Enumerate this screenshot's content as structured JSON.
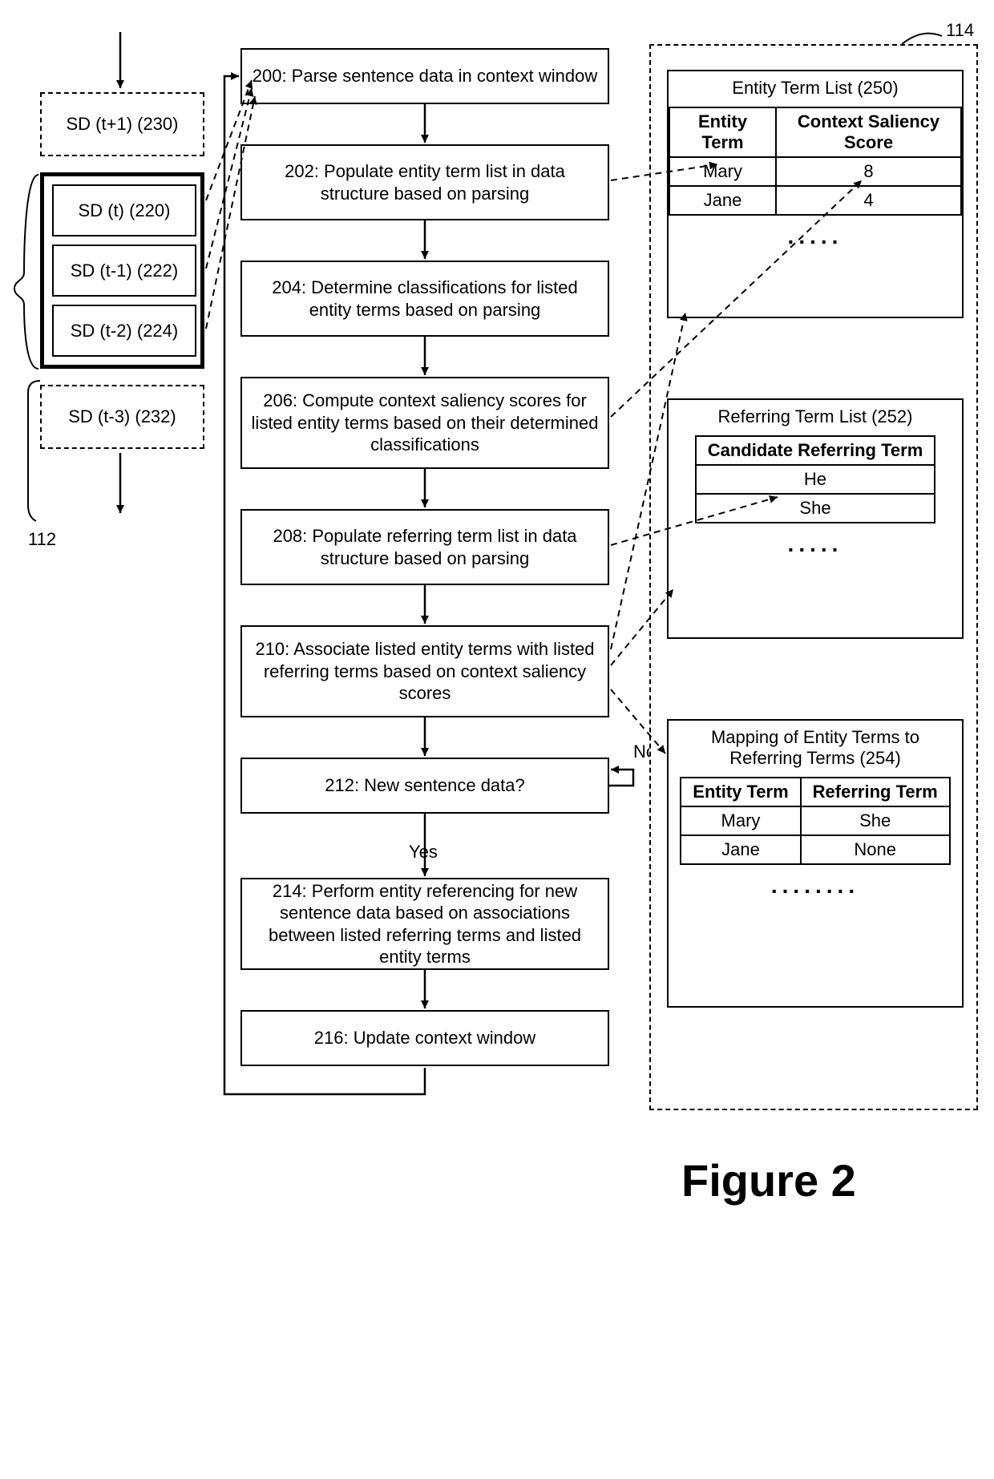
{
  "figure_label": "Figure 2",
  "refs": {
    "window_callout": "112",
    "data_structure_callout": "114"
  },
  "sd_stack": {
    "above": "SD (t+1) (230)",
    "rows": [
      "SD (t) (220)",
      "SD (t-1) (222)",
      "SD (t-2) (224)"
    ],
    "below": "SD (t-3) (232)"
  },
  "flow": {
    "s200": "200:  Parse sentence data in context window",
    "s202": "202:  Populate entity term list in data structure based on parsing",
    "s204": "204:  Determine classifications for listed entity terms based on parsing",
    "s206": "206:  Compute context saliency scores for listed entity terms based on their determined classifications",
    "s208": "208:  Populate referring term list in data structure based on parsing",
    "s210": "210:  Associate listed entity terms with listed referring terms based on context saliency scores",
    "s212": "212:  New sentence data?",
    "s214": "214:  Perform entity referencing for new sentence data based on associations between listed referring terms and listed entity terms",
    "s216": "216:  Update context window",
    "yes": "Yes",
    "no": "No"
  },
  "entity_list": {
    "title": "Entity Term List (250)",
    "headers": [
      "Entity Term",
      "Context Saliency Score"
    ],
    "rows": [
      [
        "Mary",
        "8"
      ],
      [
        "Jane",
        "4"
      ]
    ],
    "dots": "....."
  },
  "referring_list": {
    "title": "Referring Term List (252)",
    "header": "Candidate Referring Term",
    "rows": [
      "He",
      "She"
    ],
    "dots": "....."
  },
  "mapping": {
    "title": "Mapping of Entity Terms to Referring Terms (254)",
    "headers": [
      "Entity Term",
      "Referring Term"
    ],
    "rows": [
      [
        "Mary",
        "She"
      ],
      [
        "Jane",
        "None"
      ]
    ],
    "dots": "........"
  }
}
